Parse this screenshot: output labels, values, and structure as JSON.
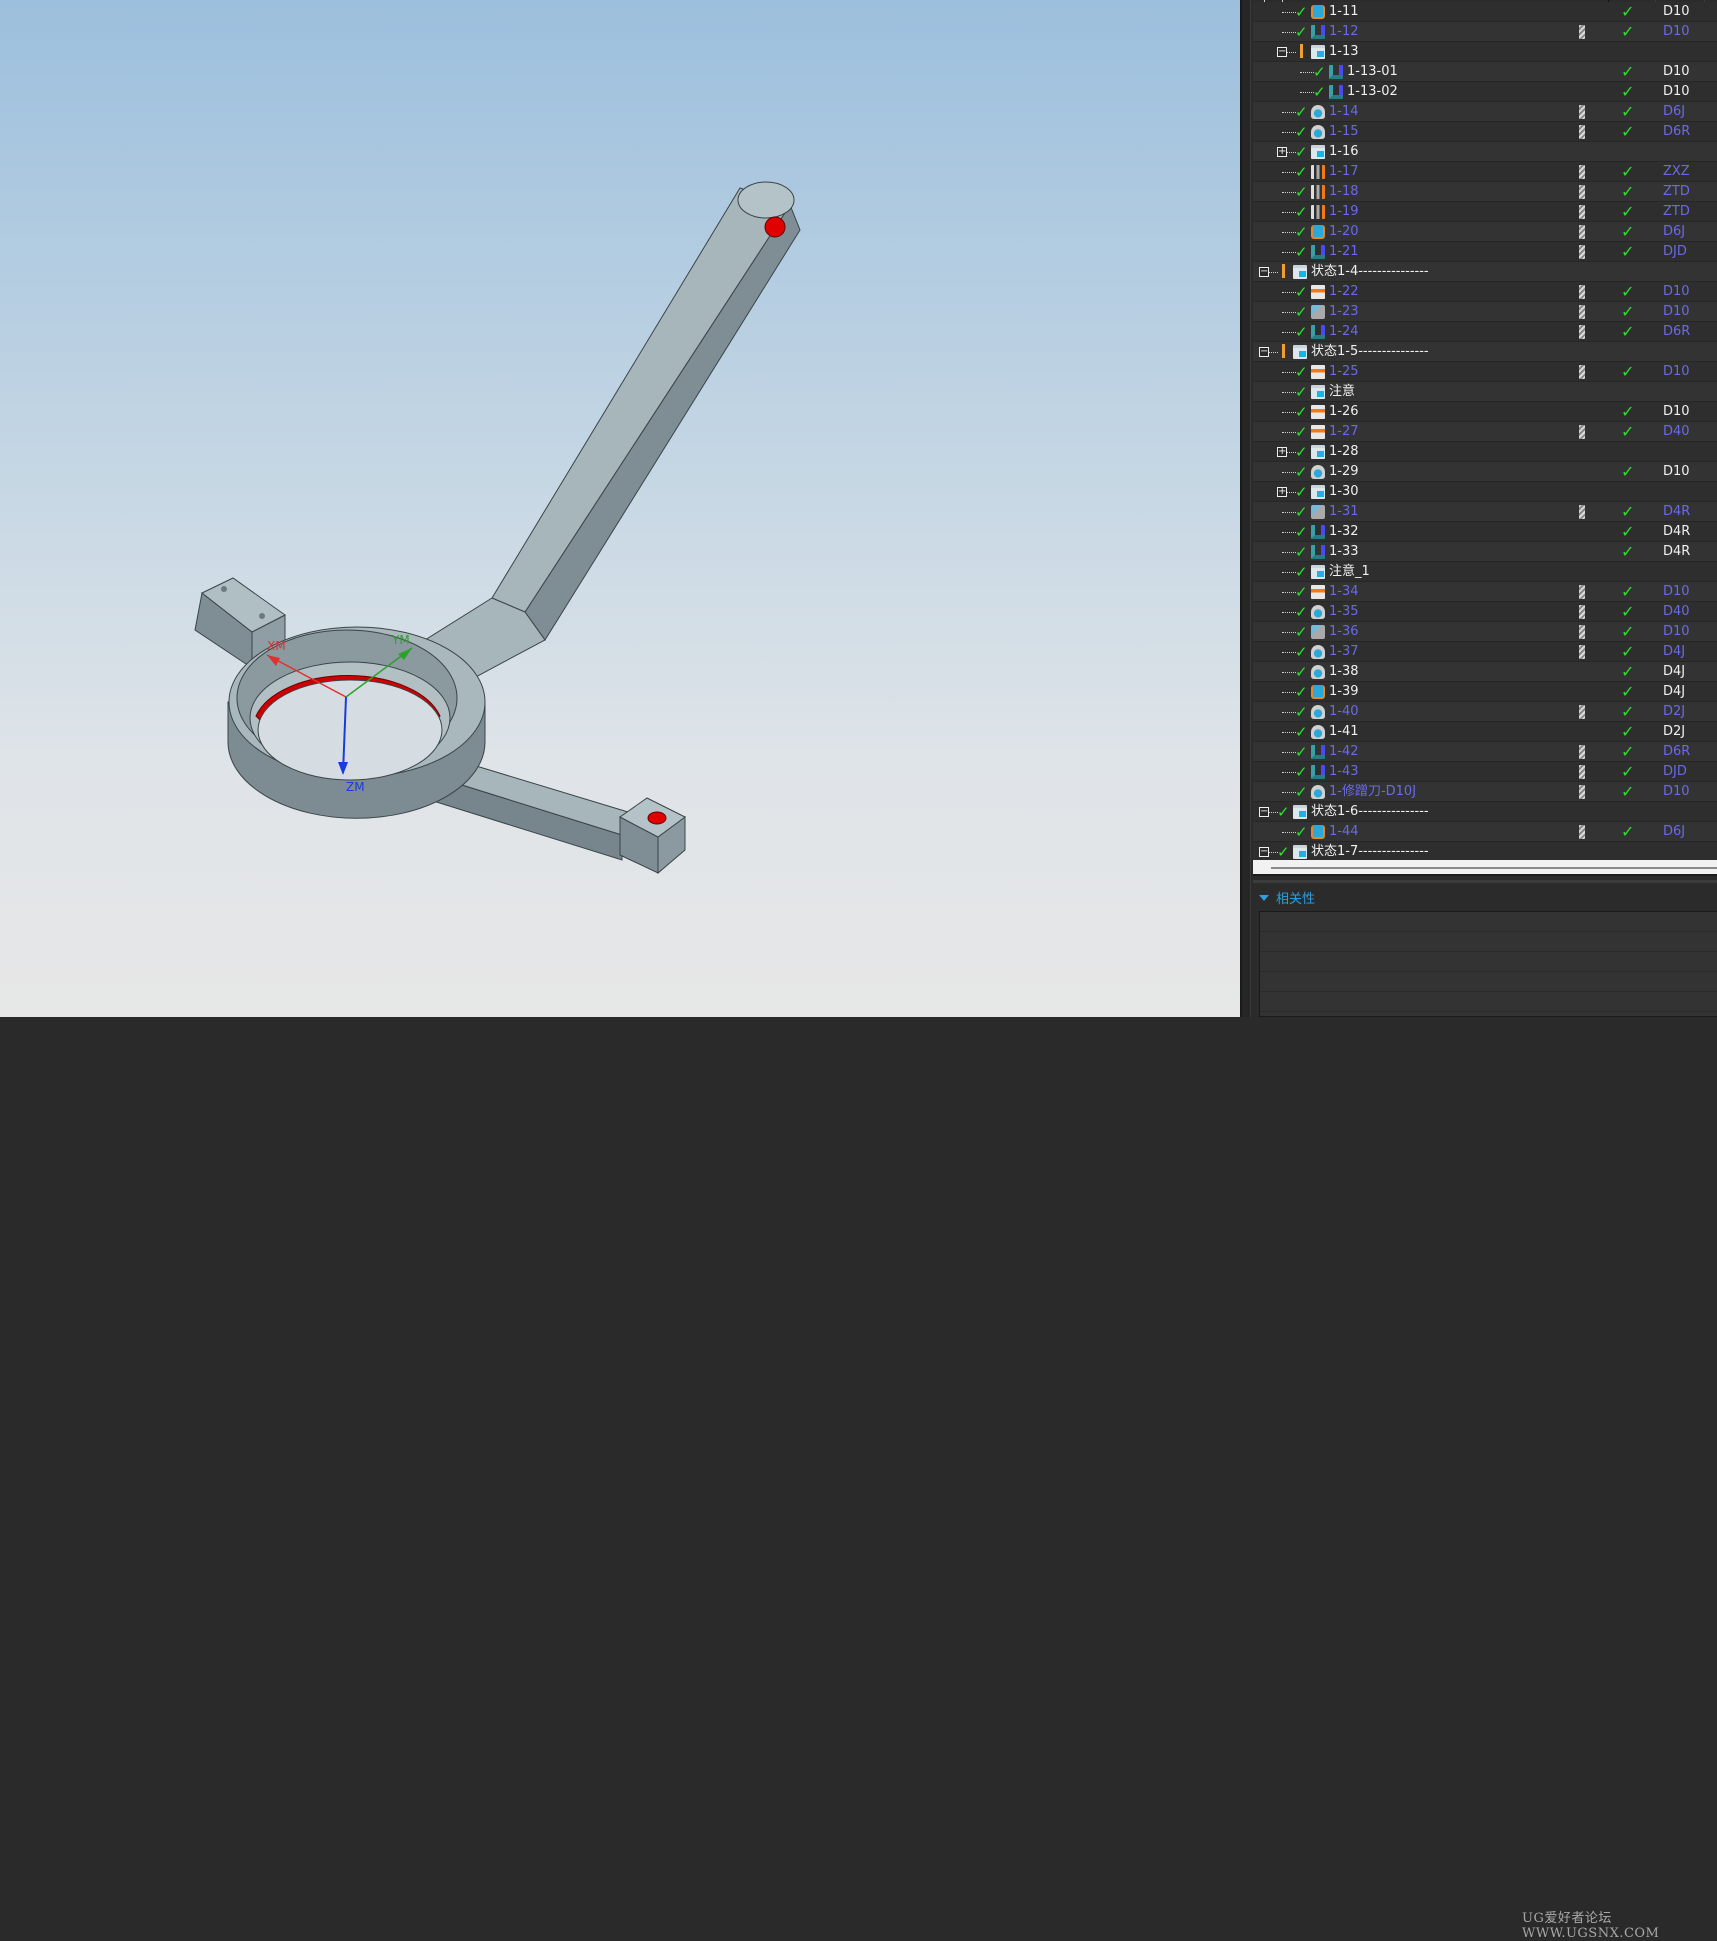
{
  "viewport": {
    "axes": {
      "x_label": "XM",
      "y_label": "YM",
      "z_label": "ZM"
    },
    "colors": {
      "part": "#9aa9ae",
      "hole": "#e00000",
      "x_axis": "#e03030",
      "y_axis": "#2ea02e",
      "z_axis": "#1a3ae0"
    }
  },
  "navigator": {
    "rows": [
      {
        "name": "1-11",
        "level": 2,
        "exp": "",
        "status": "check",
        "icon": "drill",
        "blue": false,
        "tool": false,
        "ok": true,
        "c4": "D10"
      },
      {
        "name": "1-12",
        "level": 2,
        "exp": "",
        "status": "check",
        "icon": "zlevel",
        "blue": true,
        "tool": true,
        "ok": true,
        "c4": "D10"
      },
      {
        "name": "1-13",
        "level": 2,
        "exp": "minus",
        "status": "warn",
        "icon": "folder",
        "blue": false,
        "tool": false,
        "ok": false,
        "c4": ""
      },
      {
        "name": "1-13-01",
        "level": 3,
        "exp": "",
        "status": "check",
        "icon": "zlevel",
        "blue": false,
        "tool": false,
        "ok": true,
        "c4": "D10"
      },
      {
        "name": "1-13-02",
        "level": 3,
        "exp": "",
        "status": "check",
        "icon": "zlevel",
        "blue": false,
        "tool": false,
        "ok": true,
        "c4": "D10"
      },
      {
        "name": "1-14",
        "level": 2,
        "exp": "",
        "status": "check",
        "icon": "surface",
        "blue": true,
        "tool": true,
        "ok": true,
        "c4": "D6J"
      },
      {
        "name": "1-15",
        "level": 2,
        "exp": "",
        "status": "check",
        "icon": "surface",
        "blue": true,
        "tool": true,
        "ok": true,
        "c4": "D6R"
      },
      {
        "name": "1-16",
        "level": 2,
        "exp": "plus",
        "status": "check",
        "icon": "folder",
        "blue": false,
        "tool": false,
        "ok": false,
        "c4": ""
      },
      {
        "name": "1-17",
        "level": 2,
        "exp": "",
        "status": "check",
        "icon": "plunge",
        "blue": true,
        "tool": true,
        "ok": true,
        "c4": "ZXZ"
      },
      {
        "name": "1-18",
        "level": 2,
        "exp": "",
        "status": "check",
        "icon": "plunge",
        "blue": true,
        "tool": true,
        "ok": true,
        "c4": "ZTD"
      },
      {
        "name": "1-19",
        "level": 2,
        "exp": "",
        "status": "check",
        "icon": "plunge",
        "blue": true,
        "tool": true,
        "ok": true,
        "c4": "ZTD"
      },
      {
        "name": "1-20",
        "level": 2,
        "exp": "",
        "status": "check",
        "icon": "drill",
        "blue": true,
        "tool": true,
        "ok": true,
        "c4": "D6J"
      },
      {
        "name": "1-21",
        "level": 2,
        "exp": "",
        "status": "check",
        "icon": "zlevel",
        "blue": true,
        "tool": true,
        "ok": true,
        "c4": "DJD"
      },
      {
        "name": "状态1-4---------------",
        "level": 1,
        "exp": "minus",
        "status": "warn",
        "icon": "folder",
        "blue": false,
        "tool": false,
        "ok": false,
        "c4": ""
      },
      {
        "name": "1-22",
        "level": 2,
        "exp": "",
        "status": "check",
        "icon": "planar",
        "blue": true,
        "tool": true,
        "ok": true,
        "c4": "D10"
      },
      {
        "name": "1-23",
        "level": 2,
        "exp": "",
        "status": "check",
        "icon": "contour",
        "blue": true,
        "tool": true,
        "ok": true,
        "c4": "D10"
      },
      {
        "name": "1-24",
        "level": 2,
        "exp": "",
        "status": "check",
        "icon": "zlevel",
        "blue": true,
        "tool": true,
        "ok": true,
        "c4": "D6R"
      },
      {
        "name": "状态1-5---------------",
        "level": 1,
        "exp": "minus",
        "status": "warn",
        "icon": "folder",
        "blue": false,
        "tool": false,
        "ok": false,
        "c4": ""
      },
      {
        "name": "1-25",
        "level": 2,
        "exp": "",
        "status": "check",
        "icon": "planar",
        "blue": true,
        "tool": true,
        "ok": true,
        "c4": "D10"
      },
      {
        "name": "注意",
        "level": 2,
        "exp": "",
        "status": "check",
        "icon": "folder",
        "blue": false,
        "tool": false,
        "ok": false,
        "c4": ""
      },
      {
        "name": "1-26",
        "level": 2,
        "exp": "",
        "status": "check",
        "icon": "planar",
        "blue": false,
        "tool": false,
        "ok": true,
        "c4": "D10"
      },
      {
        "name": "1-27",
        "level": 2,
        "exp": "",
        "status": "check",
        "icon": "planar",
        "blue": true,
        "tool": true,
        "ok": true,
        "c4": "D40"
      },
      {
        "name": "1-28",
        "level": 2,
        "exp": "plus",
        "status": "check",
        "icon": "folder",
        "blue": false,
        "tool": false,
        "ok": false,
        "c4": ""
      },
      {
        "name": "1-29",
        "level": 2,
        "exp": "",
        "status": "check",
        "icon": "surface",
        "blue": false,
        "tool": false,
        "ok": true,
        "c4": "D10"
      },
      {
        "name": "1-30",
        "level": 2,
        "exp": "plus",
        "status": "check",
        "icon": "folder",
        "blue": false,
        "tool": false,
        "ok": false,
        "c4": ""
      },
      {
        "name": "1-31",
        "level": 2,
        "exp": "",
        "status": "check",
        "icon": "contour",
        "blue": true,
        "tool": true,
        "ok": true,
        "c4": "D4R"
      },
      {
        "name": "1-32",
        "level": 2,
        "exp": "",
        "status": "check",
        "icon": "zlevel",
        "blue": false,
        "tool": false,
        "ok": true,
        "c4": "D4R"
      },
      {
        "name": "1-33",
        "level": 2,
        "exp": "",
        "status": "check",
        "icon": "zlevel",
        "blue": false,
        "tool": false,
        "ok": true,
        "c4": "D4R"
      },
      {
        "name": "注意_1",
        "level": 2,
        "exp": "",
        "status": "check",
        "icon": "folder",
        "blue": false,
        "tool": false,
        "ok": false,
        "c4": ""
      },
      {
        "name": "1-34",
        "level": 2,
        "exp": "",
        "status": "check",
        "icon": "planar",
        "blue": true,
        "tool": true,
        "ok": true,
        "c4": "D10"
      },
      {
        "name": "1-35",
        "level": 2,
        "exp": "",
        "status": "check",
        "icon": "surface",
        "blue": true,
        "tool": true,
        "ok": true,
        "c4": "D40"
      },
      {
        "name": "1-36",
        "level": 2,
        "exp": "",
        "status": "check",
        "icon": "contour",
        "blue": true,
        "tool": true,
        "ok": true,
        "c4": "D10"
      },
      {
        "name": "1-37",
        "level": 2,
        "exp": "",
        "status": "check",
        "icon": "surface",
        "blue": true,
        "tool": true,
        "ok": true,
        "c4": "D4J"
      },
      {
        "name": "1-38",
        "level": 2,
        "exp": "",
        "status": "check",
        "icon": "surface",
        "blue": false,
        "tool": false,
        "ok": true,
        "c4": "D4J"
      },
      {
        "name": "1-39",
        "level": 2,
        "exp": "",
        "status": "check",
        "icon": "drill",
        "blue": false,
        "tool": false,
        "ok": true,
        "c4": "D4J"
      },
      {
        "name": "1-40",
        "level": 2,
        "exp": "",
        "status": "check",
        "icon": "surface",
        "blue": true,
        "tool": true,
        "ok": true,
        "c4": "D2J"
      },
      {
        "name": "1-41",
        "level": 2,
        "exp": "",
        "status": "check",
        "icon": "surface",
        "blue": false,
        "tool": false,
        "ok": true,
        "c4": "D2J"
      },
      {
        "name": "1-42",
        "level": 2,
        "exp": "",
        "status": "check",
        "icon": "zlevel",
        "blue": true,
        "tool": true,
        "ok": true,
        "c4": "D6R"
      },
      {
        "name": "1-43",
        "level": 2,
        "exp": "",
        "status": "check",
        "icon": "zlevel",
        "blue": true,
        "tool": true,
        "ok": true,
        "c4": "DJD"
      },
      {
        "name": "1-修蹭刀-D10J",
        "level": 2,
        "exp": "",
        "status": "check",
        "icon": "surface",
        "blue": true,
        "tool": true,
        "ok": true,
        "c4": "D10"
      },
      {
        "name": "状态1-6---------------",
        "level": 1,
        "exp": "minus",
        "status": "check",
        "icon": "folder",
        "blue": false,
        "tool": false,
        "ok": false,
        "c4": ""
      },
      {
        "name": "1-44",
        "level": 2,
        "exp": "",
        "status": "check",
        "icon": "drill",
        "blue": true,
        "tool": true,
        "ok": true,
        "c4": "D6J"
      },
      {
        "name": "状态1-7---------------",
        "level": 1,
        "exp": "minus",
        "status": "check",
        "icon": "folder",
        "blue": false,
        "tool": false,
        "ok": false,
        "c4": ""
      }
    ]
  },
  "dependencies": {
    "title": "相关性"
  },
  "watermark": "UG爱好者论坛 WWW.UGSNX.COM"
}
